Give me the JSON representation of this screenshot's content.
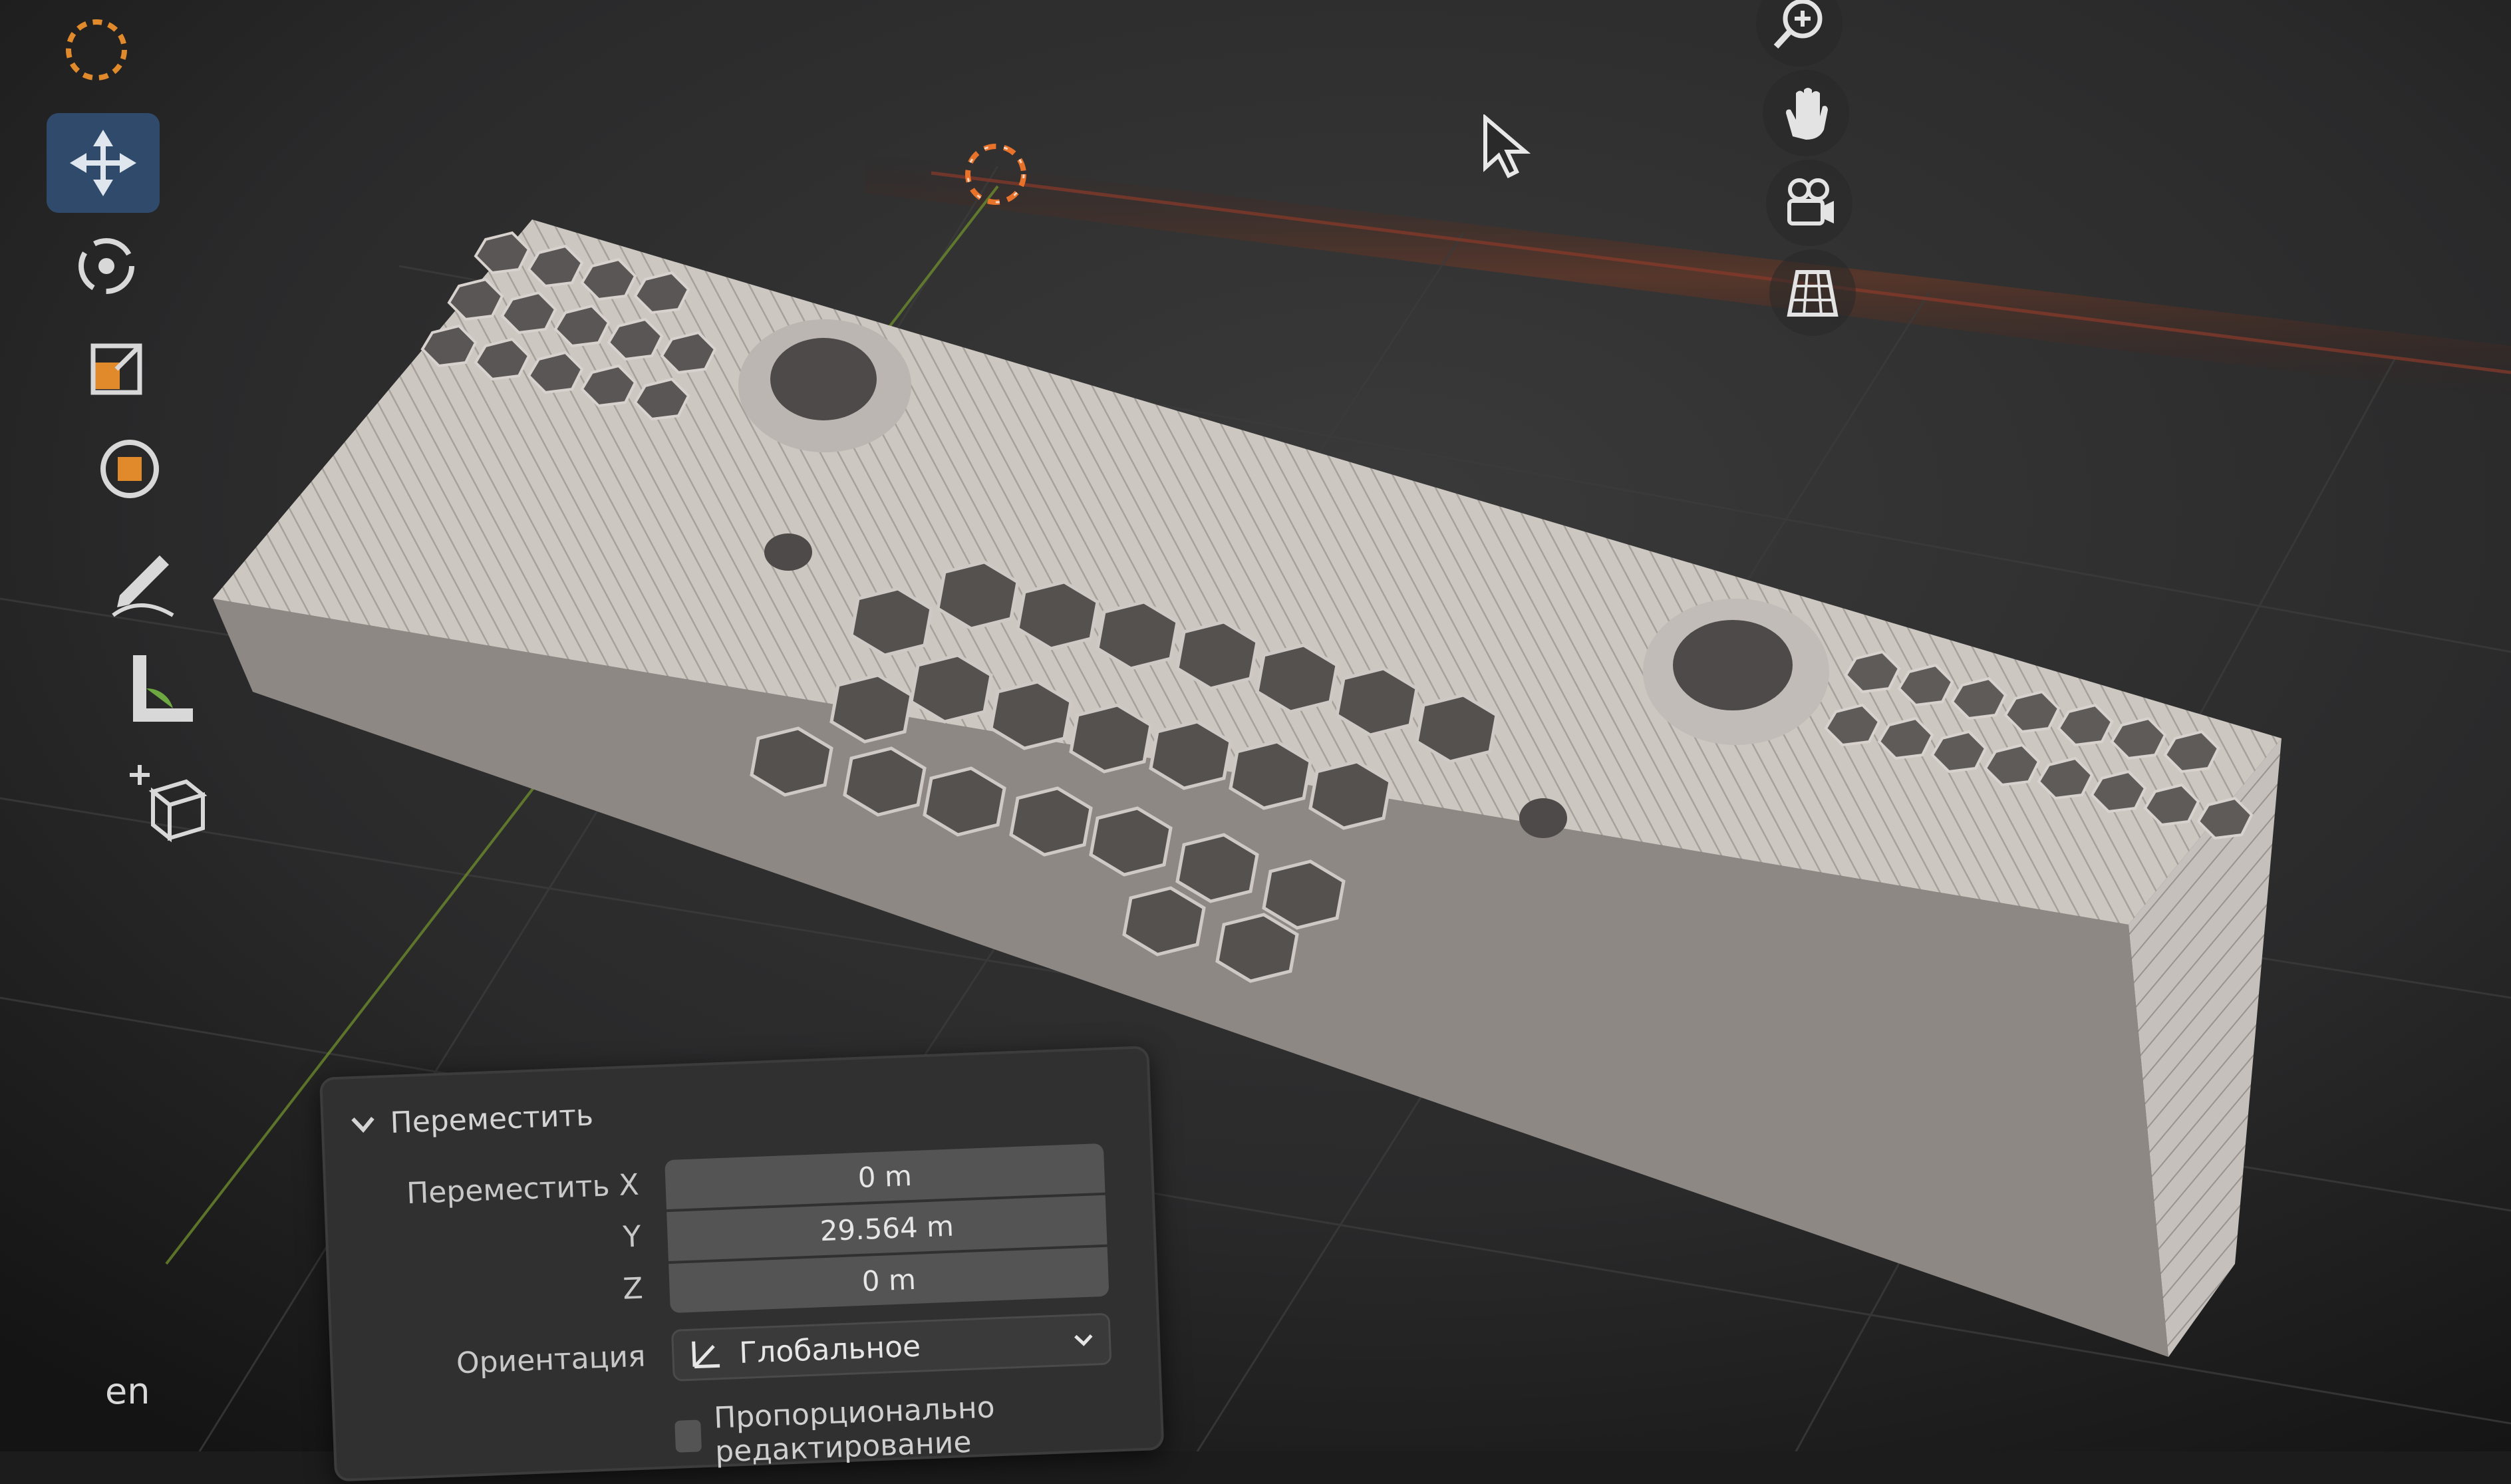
{
  "viewport": {
    "language_indicator": "en",
    "toolbar": {
      "tools": [
        {
          "name": "select-box-tool",
          "active": false
        },
        {
          "name": "move-tool",
          "active": true
        },
        {
          "name": "rotate-tool",
          "active": false
        },
        {
          "name": "scale-tool",
          "active": false
        },
        {
          "name": "transform-tool",
          "active": false
        },
        {
          "name": "annotate-tool",
          "active": false
        },
        {
          "name": "measure-tool",
          "active": false
        },
        {
          "name": "add-cube-tool",
          "active": false
        }
      ]
    },
    "nav_gizmos": [
      "zoom-icon",
      "hand-pan-icon",
      "camera-icon",
      "grid-perspective-icon"
    ],
    "colors": {
      "active_tool": "#2f4a6b",
      "model": "#bdb7b3",
      "accent_orange": "#e8722a"
    }
  },
  "operator_panel": {
    "title": "Переместить",
    "move_x_label": "Переместить X",
    "y_label": "Y",
    "z_label": "Z",
    "x_value": "0 m",
    "y_value": "29.564 m",
    "z_value": "0 m",
    "orientation_label": "Ориентация",
    "orientation_value": "Глобальное",
    "proportional_label": "Пропорционально редактирование"
  }
}
